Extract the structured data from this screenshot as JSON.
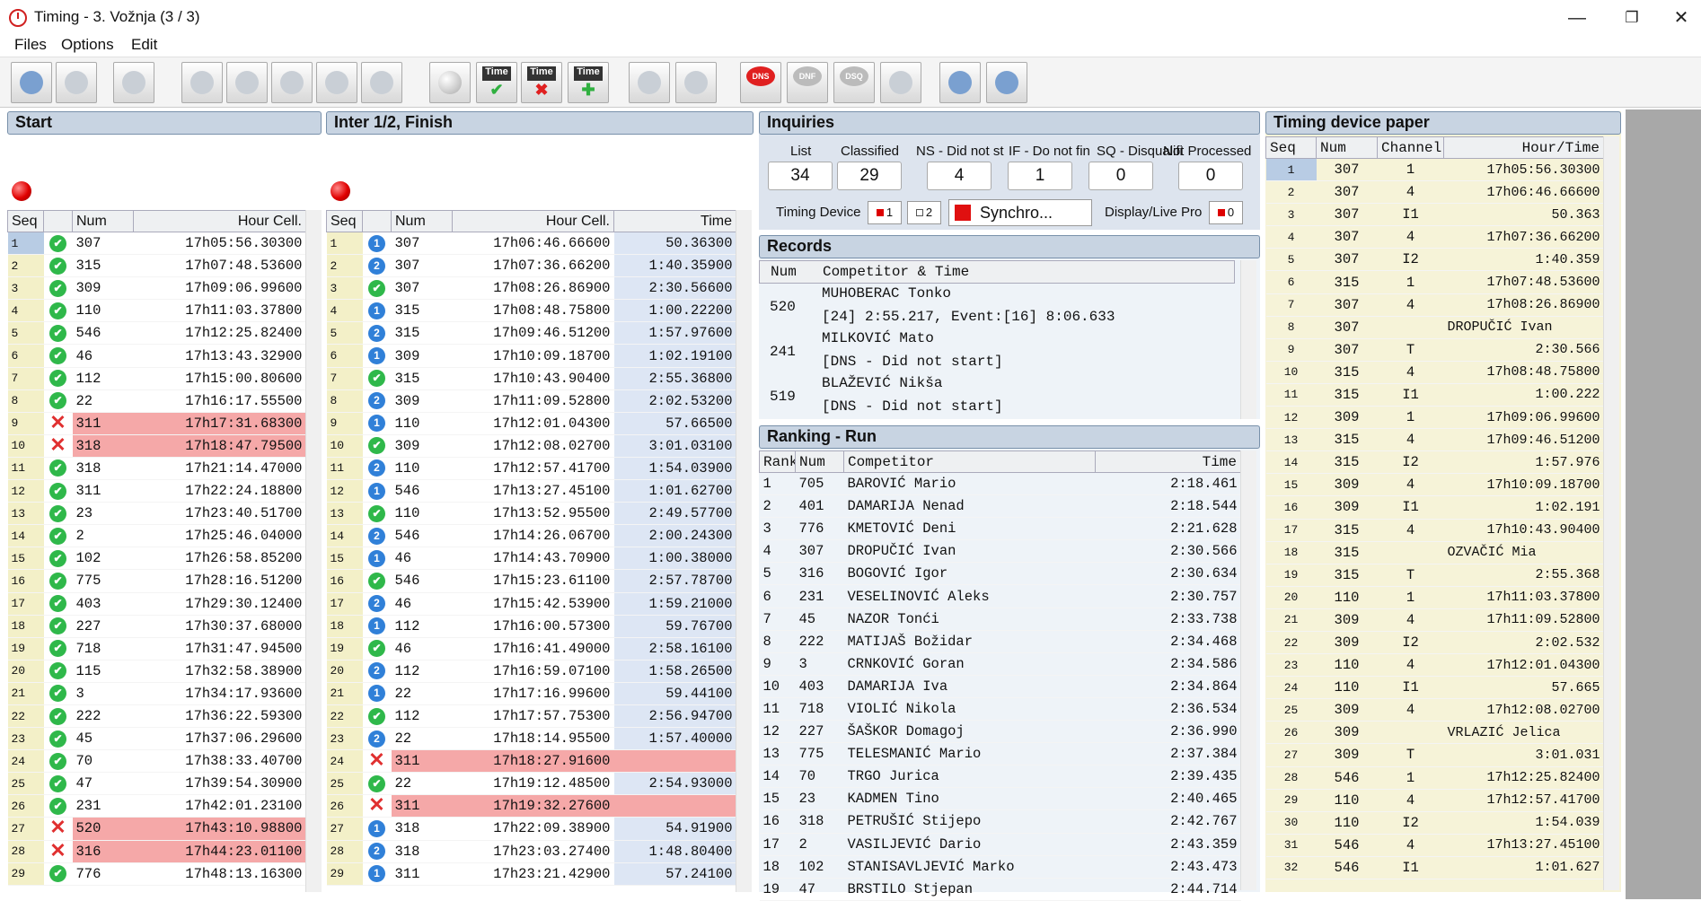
{
  "window": {
    "app": "Timing",
    "title": "Timing -   3. Vožnja (3 / 3)",
    "min": "—",
    "restore": "❐",
    "close": "✕"
  },
  "menu": [
    "Files",
    "Options",
    "Edit"
  ],
  "toolbar": [
    {
      "icon": "competitor-icon",
      "label": ""
    },
    {
      "icon": "list-icon",
      "label": ""
    },
    {
      "icon": "grid-icon",
      "label": ""
    },
    {
      "icon": "clock-icon",
      "label": ""
    },
    {
      "icon": "print-icon",
      "label": ""
    },
    {
      "icon": "print-x-icon",
      "label": ""
    },
    {
      "icon": "print-arrow-icon",
      "label": ""
    },
    {
      "icon": "print-alt-icon",
      "label": ""
    },
    {
      "icon": "circle-icon",
      "label": ""
    },
    {
      "icon": "time-ok-icon",
      "label": "Time"
    },
    {
      "icon": "time-delete-icon",
      "label": "Time"
    },
    {
      "icon": "time-add-icon",
      "label": "Time"
    },
    {
      "icon": "move-up-icon",
      "label": ""
    },
    {
      "icon": "move-down-icon",
      "label": ""
    },
    {
      "icon": "dns-icon",
      "label": "DNS"
    },
    {
      "icon": "dnf-icon",
      "label": "DNF"
    },
    {
      "icon": "dsq-icon",
      "label": "DSQ"
    },
    {
      "icon": "clear-icon",
      "label": ""
    },
    {
      "icon": "search-user-icon",
      "label": ""
    },
    {
      "icon": "info-user-icon",
      "label": ""
    }
  ],
  "start": {
    "title": "Start",
    "headers": [
      "Seq",
      "",
      "Num",
      "Hour Cell."
    ],
    "rows": [
      [
        "1",
        "ok",
        "307",
        "17h05:56.30300"
      ],
      [
        "2",
        "ok",
        "315",
        "17h07:48.53600"
      ],
      [
        "3",
        "ok",
        "309",
        "17h09:06.99600"
      ],
      [
        "4",
        "ok",
        "110",
        "17h11:03.37800"
      ],
      [
        "5",
        "ok",
        "546",
        "17h12:25.82400"
      ],
      [
        "6",
        "ok",
        "46",
        "17h13:43.32900"
      ],
      [
        "7",
        "ok",
        "112",
        "17h15:00.80600"
      ],
      [
        "8",
        "ok",
        "22",
        "17h16:17.55500"
      ],
      [
        "9",
        "err",
        "311",
        "17h17:31.68300"
      ],
      [
        "10",
        "err",
        "318",
        "17h18:47.79500"
      ],
      [
        "11",
        "ok",
        "318",
        "17h21:14.47000"
      ],
      [
        "12",
        "ok",
        "311",
        "17h22:24.18800"
      ],
      [
        "13",
        "ok",
        "23",
        "17h23:40.51700"
      ],
      [
        "14",
        "ok",
        "2",
        "17h25:46.04000"
      ],
      [
        "15",
        "ok",
        "102",
        "17h26:58.85200"
      ],
      [
        "16",
        "ok",
        "775",
        "17h28:16.51200"
      ],
      [
        "17",
        "ok",
        "403",
        "17h29:30.12400"
      ],
      [
        "18",
        "ok",
        "227",
        "17h30:37.68000"
      ],
      [
        "19",
        "ok",
        "718",
        "17h31:47.94500"
      ],
      [
        "20",
        "ok",
        "115",
        "17h32:58.38900"
      ],
      [
        "21",
        "ok",
        "3",
        "17h34:17.93600"
      ],
      [
        "22",
        "ok",
        "222",
        "17h36:22.59300"
      ],
      [
        "23",
        "ok",
        "45",
        "17h37:06.29600"
      ],
      [
        "24",
        "ok",
        "70",
        "17h38:33.40700"
      ],
      [
        "25",
        "ok",
        "47",
        "17h39:54.30900"
      ],
      [
        "26",
        "ok",
        "231",
        "17h42:01.23100"
      ],
      [
        "27",
        "err",
        "520",
        "17h43:10.98800"
      ],
      [
        "28",
        "err",
        "316",
        "17h44:23.01100"
      ],
      [
        "29",
        "ok",
        "776",
        "17h48:13.16300"
      ]
    ]
  },
  "inter": {
    "title": "Inter 1/2, Finish",
    "headers": [
      "Seq",
      "",
      "Num",
      "Hour Cell.",
      "Time"
    ],
    "rows": [
      [
        "1",
        "i1",
        "307",
        "17h06:46.66600",
        "50.36300"
      ],
      [
        "2",
        "i2",
        "307",
        "17h07:36.66200",
        "1:40.35900"
      ],
      [
        "3",
        "ok",
        "307",
        "17h08:26.86900",
        "2:30.56600"
      ],
      [
        "4",
        "i1",
        "315",
        "17h08:48.75800",
        "1:00.22200"
      ],
      [
        "5",
        "i2",
        "315",
        "17h09:46.51200",
        "1:57.97600"
      ],
      [
        "6",
        "i1",
        "309",
        "17h10:09.18700",
        "1:02.19100"
      ],
      [
        "7",
        "ok",
        "315",
        "17h10:43.90400",
        "2:55.36800"
      ],
      [
        "8",
        "i2",
        "309",
        "17h11:09.52800",
        "2:02.53200"
      ],
      [
        "9",
        "i1",
        "110",
        "17h12:01.04300",
        "57.66500"
      ],
      [
        "10",
        "ok",
        "309",
        "17h12:08.02700",
        "3:01.03100"
      ],
      [
        "11",
        "i2",
        "110",
        "17h12:57.41700",
        "1:54.03900"
      ],
      [
        "12",
        "i1",
        "546",
        "17h13:27.45100",
        "1:01.62700"
      ],
      [
        "13",
        "ok",
        "110",
        "17h13:52.95500",
        "2:49.57700"
      ],
      [
        "14",
        "i2",
        "546",
        "17h14:26.06700",
        "2:00.24300"
      ],
      [
        "15",
        "i1",
        "46",
        "17h14:43.70900",
        "1:00.38000"
      ],
      [
        "16",
        "ok",
        "546",
        "17h15:23.61100",
        "2:57.78700"
      ],
      [
        "17",
        "i2",
        "46",
        "17h15:42.53900",
        "1:59.21000"
      ],
      [
        "18",
        "i1",
        "112",
        "17h16:00.57300",
        "59.76700"
      ],
      [
        "19",
        "ok",
        "46",
        "17h16:41.49000",
        "2:58.16100"
      ],
      [
        "20",
        "i2",
        "112",
        "17h16:59.07100",
        "1:58.26500"
      ],
      [
        "21",
        "i1",
        "22",
        "17h17:16.99600",
        "59.44100"
      ],
      [
        "22",
        "ok",
        "112",
        "17h17:57.75300",
        "2:56.94700"
      ],
      [
        "23",
        "i2",
        "22",
        "17h18:14.95500",
        "1:57.40000"
      ],
      [
        "24",
        "err",
        "311",
        "17h18:27.91600",
        ""
      ],
      [
        "25",
        "ok",
        "22",
        "17h19:12.48500",
        "2:54.93000"
      ],
      [
        "26",
        "err",
        "311",
        "17h19:32.27600",
        ""
      ],
      [
        "27",
        "i1",
        "318",
        "17h22:09.38900",
        "54.91900"
      ],
      [
        "28",
        "i2",
        "318",
        "17h23:03.27400",
        "1:48.80400"
      ],
      [
        "29",
        "i1",
        "311",
        "17h23:21.42900",
        "57.24100"
      ]
    ]
  },
  "inquiries": {
    "title": "Inquiries",
    "labels": [
      "List",
      "Classified",
      "NS - Did not st",
      "IF - Do not fin",
      "SQ - Disqualifi",
      "Not Processed"
    ],
    "values": [
      "34",
      "29",
      "4",
      "1",
      "0",
      "0"
    ],
    "timing_device": "Timing Device",
    "dev1": "1",
    "dev2": "2",
    "synchro": "Synchro...",
    "display": "Display/Live Pro",
    "display_val": "0"
  },
  "records": {
    "title": "Records",
    "headers": [
      "Num",
      "Competitor & Time"
    ],
    "rows": [
      {
        "num": "520",
        "name": "MUHOBERAC Tonko",
        "info": "[24] 2:55.217, Event:[16] 8:06.633"
      },
      {
        "num": "241",
        "name": "MILKOVIĆ Mato",
        "info": "[DNS - Did not start]"
      },
      {
        "num": "519",
        "name": "BLAŽEVIĆ Nikša",
        "info": "[DNS - Did not start]"
      }
    ]
  },
  "ranking": {
    "title": "Ranking - Run",
    "headers": [
      "Rank",
      "Num",
      "Competitor",
      "Time"
    ],
    "rows": [
      [
        "1",
        "705",
        "BAROVIĆ Mario",
        "2:18.461"
      ],
      [
        "2",
        "401",
        "DAMARIJA Nenad",
        "2:18.544"
      ],
      [
        "3",
        "776",
        "KMETOVIĆ Deni",
        "2:21.628"
      ],
      [
        "4",
        "307",
        "DROPUČIĆ Ivan",
        "2:30.566"
      ],
      [
        "5",
        "316",
        "BOGOVIĆ Igor",
        "2:30.634"
      ],
      [
        "6",
        "231",
        "VESELINOVIĆ Aleks",
        "2:30.757"
      ],
      [
        "7",
        "45",
        "NAZOR Tonći",
        "2:33.738"
      ],
      [
        "8",
        "222",
        "MATIJAŠ Božidar",
        "2:34.468"
      ],
      [
        "9",
        "3",
        "CRNKOVIĆ Goran",
        "2:34.586"
      ],
      [
        "10",
        "403",
        "DAMARIJA Iva",
        "2:34.864"
      ],
      [
        "11",
        "718",
        "VIOLIĆ Nikola",
        "2:36.534"
      ],
      [
        "12",
        "227",
        "ŠAŠKOR Domagoj",
        "2:36.990"
      ],
      [
        "13",
        "775",
        "TELESMANIĆ Mario",
        "2:37.384"
      ],
      [
        "14",
        "70",
        "TRGO Jurica",
        "2:39.435"
      ],
      [
        "15",
        "23",
        "KADMEN Tino",
        "2:40.465"
      ],
      [
        "16",
        "318",
        "PETRUŠIĆ Stijepo",
        "2:42.767"
      ],
      [
        "17",
        "2",
        "VASILJEVIĆ Dario",
        "2:43.359"
      ],
      [
        "18",
        "102",
        "STANISAVLJEVIĆ Marko",
        "2:43.473"
      ],
      [
        "19",
        "47",
        "BRSTILO Stjepan",
        "2:44.714"
      ]
    ]
  },
  "paper": {
    "title": "Timing device paper",
    "headers": [
      "Seq",
      "Num",
      "Channel",
      "Hour/Time"
    ],
    "rows": [
      [
        "1",
        "307",
        "1",
        "17h05:56.30300"
      ],
      [
        "2",
        "307",
        "4",
        "17h06:46.66600"
      ],
      [
        "3",
        "307",
        "I1",
        "50.363"
      ],
      [
        "4",
        "307",
        "4",
        "17h07:36.66200"
      ],
      [
        "5",
        "307",
        "I2",
        "1:40.359"
      ],
      [
        "6",
        "315",
        "1",
        "17h07:48.53600"
      ],
      [
        "7",
        "307",
        "4",
        "17h08:26.86900"
      ],
      [
        "8",
        "307",
        "",
        "DROPUČIĆ Ivan"
      ],
      [
        "9",
        "307",
        "T",
        "2:30.566"
      ],
      [
        "10",
        "315",
        "4",
        "17h08:48.75800"
      ],
      [
        "11",
        "315",
        "I1",
        "1:00.222"
      ],
      [
        "12",
        "309",
        "1",
        "17h09:06.99600"
      ],
      [
        "13",
        "315",
        "4",
        "17h09:46.51200"
      ],
      [
        "14",
        "315",
        "I2",
        "1:57.976"
      ],
      [
        "15",
        "309",
        "4",
        "17h10:09.18700"
      ],
      [
        "16",
        "309",
        "I1",
        "1:02.191"
      ],
      [
        "17",
        "315",
        "4",
        "17h10:43.90400"
      ],
      [
        "18",
        "315",
        "",
        "OZVAČIĆ Mia"
      ],
      [
        "19",
        "315",
        "T",
        "2:55.368"
      ],
      [
        "20",
        "110",
        "1",
        "17h11:03.37800"
      ],
      [
        "21",
        "309",
        "4",
        "17h11:09.52800"
      ],
      [
        "22",
        "309",
        "I2",
        "2:02.532"
      ],
      [
        "23",
        "110",
        "4",
        "17h12:01.04300"
      ],
      [
        "24",
        "110",
        "I1",
        "57.665"
      ],
      [
        "25",
        "309",
        "4",
        "17h12:08.02700"
      ],
      [
        "26",
        "309",
        "",
        "VRLAZIĆ Jelica"
      ],
      [
        "27",
        "309",
        "T",
        "3:01.031"
      ],
      [
        "28",
        "546",
        "1",
        "17h12:25.82400"
      ],
      [
        "29",
        "110",
        "4",
        "17h12:57.41700"
      ],
      [
        "30",
        "110",
        "I2",
        "1:54.039"
      ],
      [
        "31",
        "546",
        "4",
        "17h13:27.45100"
      ],
      [
        "32",
        "546",
        "I1",
        "1:01.627"
      ]
    ]
  }
}
